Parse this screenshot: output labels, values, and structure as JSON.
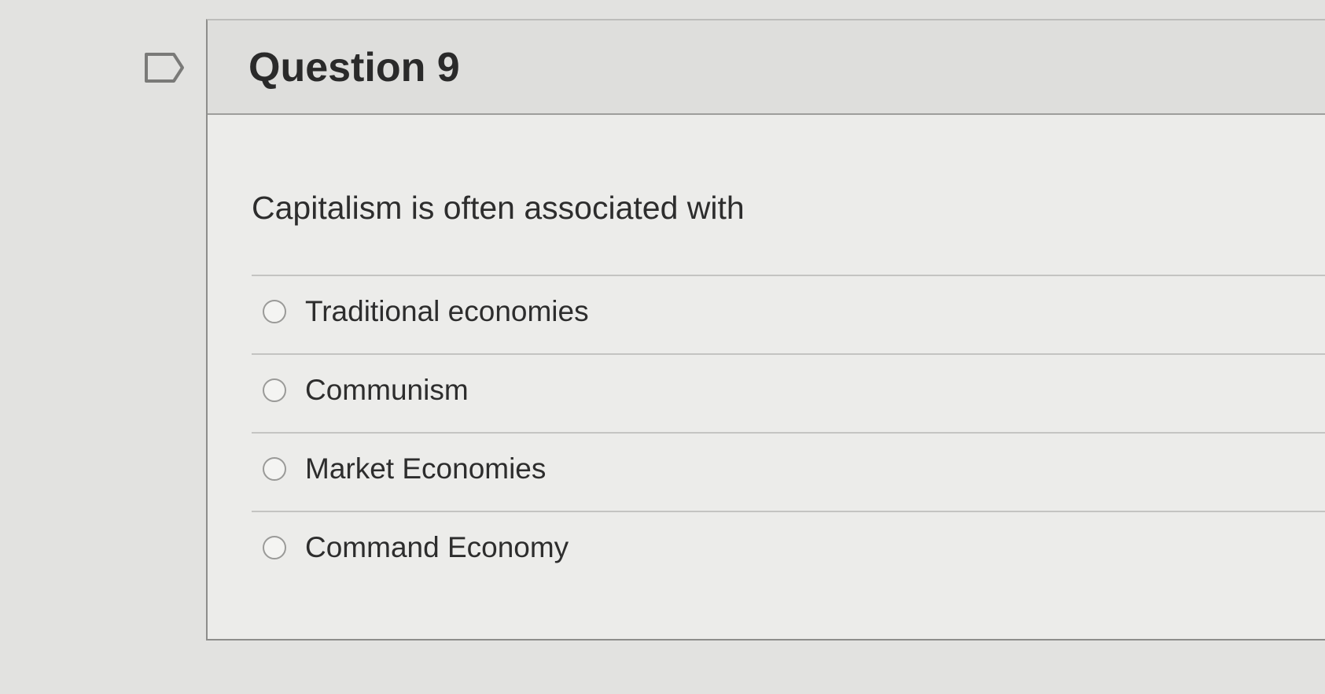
{
  "question": {
    "title": "Question 9",
    "text": "Capitalism is often associated with",
    "answers": [
      {
        "label": "Traditional economies",
        "selected": false
      },
      {
        "label": "Communism",
        "selected": false
      },
      {
        "label": "Market Economies",
        "selected": false
      },
      {
        "label": "Command Economy",
        "selected": false
      }
    ]
  },
  "colors": {
    "background": "#e2e2e0",
    "card": "#ececea",
    "header": "#dededc",
    "text": "#2d2d2d",
    "divider": "#c4c4c2"
  },
  "icons": {
    "flag": "flag-question-icon",
    "radio": "radio-button-icon"
  }
}
